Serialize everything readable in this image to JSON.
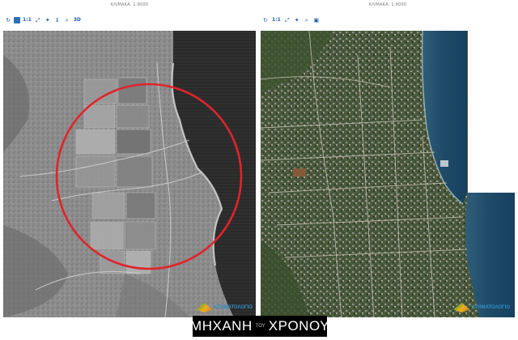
{
  "left_panel": {
    "scale_label": "ΚΛΙΜΑΚΑ: 1:8000",
    "toolbar": [
      {
        "name": "refresh-icon",
        "glyph": "↻"
      },
      {
        "name": "bookmark-icon",
        "glyph": "◨"
      },
      {
        "name": "zoom-1-text",
        "glyph": "1:1"
      },
      {
        "name": "zoom-extent-icon",
        "glyph": "⤢"
      },
      {
        "name": "orient-icon",
        "glyph": "✦"
      },
      {
        "name": "info-icon",
        "glyph": "ℹ"
      },
      {
        "name": "search-icon",
        "glyph": "⌕"
      },
      {
        "name": "view-3d-text",
        "glyph": "3D"
      }
    ],
    "watermark": "ΚΤΗΜΑΤΟΛΟΓΙΟ"
  },
  "right_panel": {
    "scale_label": "ΚΛΙΜΑΚΑ: 1:8000",
    "toolbar": [
      {
        "name": "refresh-icon",
        "glyph": "↻"
      },
      {
        "name": "zoom-1-text",
        "glyph": "1:1"
      },
      {
        "name": "zoom-extent-icon",
        "glyph": "⤢"
      },
      {
        "name": "orient-icon",
        "glyph": "✦"
      },
      {
        "name": "search-icon",
        "glyph": "⌕"
      },
      {
        "name": "layer-icon",
        "glyph": "▣"
      }
    ],
    "watermark": "ΚΤΗΜΑΤΟΛΟΓΙΟ"
  },
  "banner": {
    "left": "ΜΗΧΑΝΗ",
    "middle": "ΤΟΥ",
    "right": "ΧΡΟΝΟΥ"
  }
}
